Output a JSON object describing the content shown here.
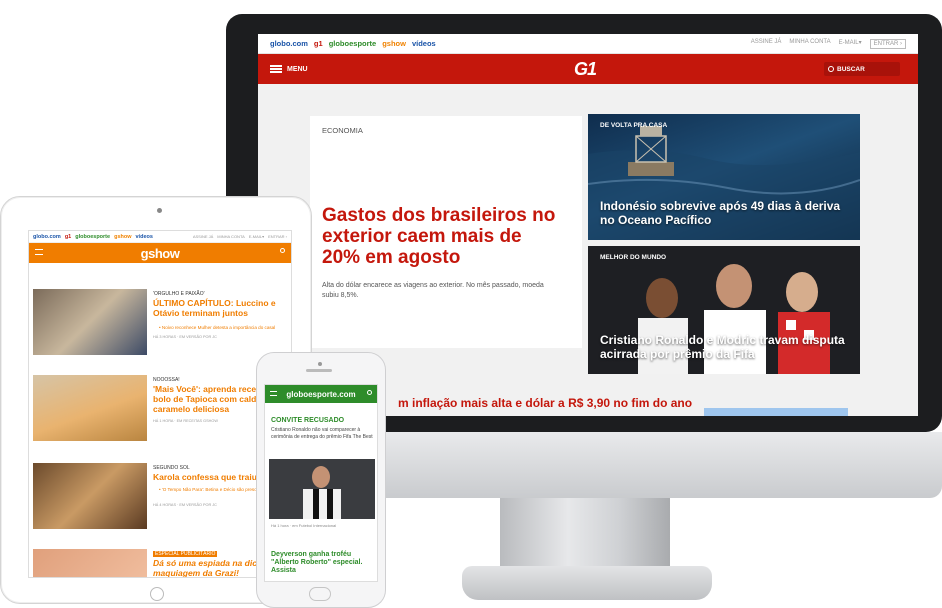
{
  "colors": {
    "g1_red": "#c4170c",
    "gshow_orange": "#f07d00",
    "ge_green": "#2e8c2a",
    "globo_blue": "#1a54a8"
  },
  "desktop": {
    "topbar": {
      "links": [
        "globo.com",
        "g1",
        "globoesporte",
        "gshow",
        "vídeos"
      ],
      "right": [
        "ASSINE JÁ",
        "MINHA CONTA",
        "E-MAIL▾",
        "ENTRAR ›"
      ]
    },
    "header": {
      "menu_label": "MENU",
      "logo": "G1",
      "search_label": "BUSCAR"
    },
    "main_story": {
      "kicker": "ECONOMIA",
      "headline": "Gastos dos brasileiros no exterior caem mais de 20% em agosto",
      "summary": "Alta do dólar encarece as viagens ao exterior. No mês passado, moeda subiu 8,5%."
    },
    "story_2": {
      "tag": "DE VOLTA PRA CASA",
      "caption": "Indonésio sobrevive após 49 dias à deriva no Oceano Pacífico"
    },
    "story_3": {
      "tag": "MELHOR DO MUNDO",
      "caption": "Cristiano Ronaldo e Modric travam disputa acirrada por prêmio da Fifa"
    },
    "bottom_headline": "m inflação mais alta e dólar a R$ 3,90 no fim do ano"
  },
  "tablet": {
    "topbar": {
      "links": [
        "globo.com",
        "g1",
        "globoesporte",
        "gshow",
        "vídeos"
      ],
      "right": [
        "ASSINE JÁ",
        "MINHA CONTA",
        "E-MAIL▾",
        "ENTRAR ›"
      ]
    },
    "logo": "gshow",
    "items": [
      {
        "kicker": "'ORGULHO E PAIXÃO'",
        "title": "ÚLTIMO CAPÍTULO: Luccino e Otávio terminam juntos",
        "sub": "• Noivo reconhece Mulher detesta a importância do casal",
        "meta": "HÁ 3 HORAS · EM VERSÃO POR JC"
      },
      {
        "kicker": "NOOOSSA!",
        "title": "'Mais Você': aprenda receita de bolo de Tapioca com calda de caramelo deliciosa",
        "sub": "",
        "meta": "HÁ 1 HORA · EM RECEITAS GSHOW"
      },
      {
        "kicker": "SEGUNDO SOL",
        "title": "Karola confessa que traiu Lau...",
        "sub": "• 'O Tempo Não Para': Betina e Décio são presos pelos policiais",
        "meta": "HÁ 4 HORAS · EM VERSÃO POR JC"
      },
      {
        "kicker": "ESPECIAL PUBLICITÁRIO",
        "title": "Dá só uma espiada na dica de maquiagem da Grazi!",
        "sub": "",
        "meta": ""
      }
    ]
  },
  "phone": {
    "logo": "globoesporte.com",
    "story_1": {
      "title": "CONVITE RECUSADO",
      "text": "Cristiano Ronaldo não vai comparecer à cerimônia de entrega do prêmio Fifa The Best"
    },
    "caption": "Há 1 hora · em Futebol Internacional",
    "story_2": {
      "title": "Deyverson ganha troféu \"Alberto Roberto\" especial. Assista"
    }
  }
}
